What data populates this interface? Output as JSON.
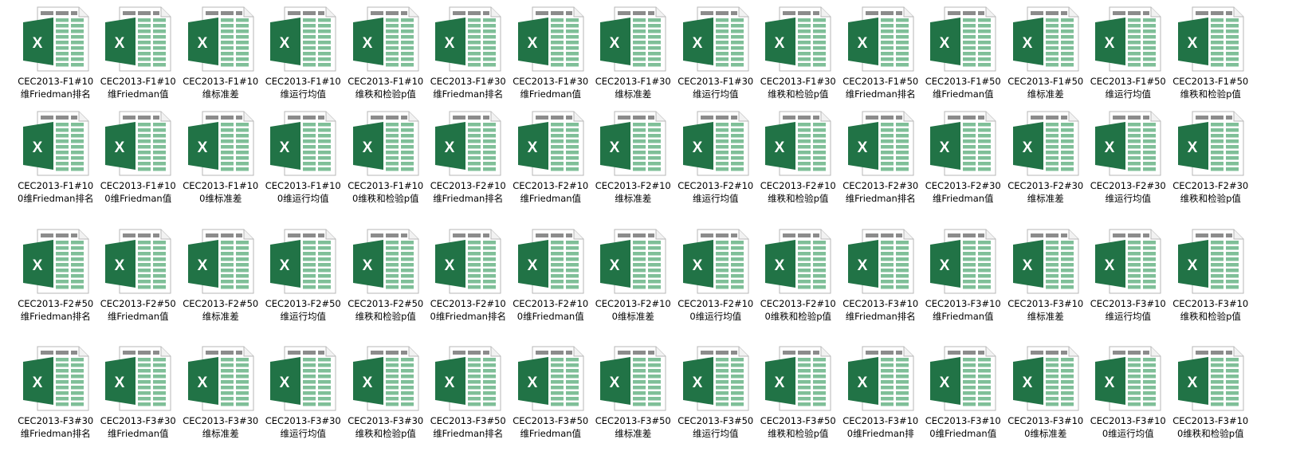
{
  "folder": {
    "files": [
      {
        "name": "CEC2013-F1#10维Friedman排名"
      },
      {
        "name": "CEC2013-F1#10维Friedman值"
      },
      {
        "name": "CEC2013-F1#10维标准差"
      },
      {
        "name": "CEC2013-F1#10维运行均值"
      },
      {
        "name": "CEC2013-F1#10维秩和检验p值"
      },
      {
        "name": "CEC2013-F1#30维Friedman排名"
      },
      {
        "name": "CEC2013-F1#30维Friedman值"
      },
      {
        "name": "CEC2013-F1#30维标准差"
      },
      {
        "name": "CEC2013-F1#30维运行均值"
      },
      {
        "name": "CEC2013-F1#30维秩和检验p值"
      },
      {
        "name": "CEC2013-F1#50维Friedman排名"
      },
      {
        "name": "CEC2013-F1#50维Friedman值"
      },
      {
        "name": "CEC2013-F1#50维标准差"
      },
      {
        "name": "CEC2013-F1#50维运行均值"
      },
      {
        "name": "CEC2013-F1#50维秩和检验p值"
      },
      {
        "name": "CEC2013-F1#100维Friedman排名"
      },
      {
        "name": "CEC2013-F1#100维Friedman值"
      },
      {
        "name": "CEC2013-F1#100维标准差"
      },
      {
        "name": "CEC2013-F1#100维运行均值"
      },
      {
        "name": "CEC2013-F1#100维秩和检验p值"
      },
      {
        "name": "CEC2013-F2#10维Friedman排名"
      },
      {
        "name": "CEC2013-F2#10维Friedman值"
      },
      {
        "name": "CEC2013-F2#10维标准差"
      },
      {
        "name": "CEC2013-F2#10维运行均值"
      },
      {
        "name": "CEC2013-F2#10维秩和检验p值"
      },
      {
        "name": "CEC2013-F2#30维Friedman排名"
      },
      {
        "name": "CEC2013-F2#30维Friedman值"
      },
      {
        "name": "CEC2013-F2#30维标准差"
      },
      {
        "name": "CEC2013-F2#30维运行均值"
      },
      {
        "name": "CEC2013-F2#30维秩和检验p值"
      },
      {
        "name": "CEC2013-F2#50维Friedman排名"
      },
      {
        "name": "CEC2013-F2#50维Friedman值"
      },
      {
        "name": "CEC2013-F2#50维标准差"
      },
      {
        "name": "CEC2013-F2#50维运行均值"
      },
      {
        "name": "CEC2013-F2#50维秩和检验p值"
      },
      {
        "name": "CEC2013-F2#100维Friedman排名"
      },
      {
        "name": "CEC2013-F2#100维Friedman值"
      },
      {
        "name": "CEC2013-F2#100维标准差"
      },
      {
        "name": "CEC2013-F2#100维运行均值"
      },
      {
        "name": "CEC2013-F2#100维秩和检验p值"
      },
      {
        "name": "CEC2013-F3#10维Friedman排名"
      },
      {
        "name": "CEC2013-F3#10维Friedman值"
      },
      {
        "name": "CEC2013-F3#10维标准差"
      },
      {
        "name": "CEC2013-F3#10维运行均值"
      },
      {
        "name": "CEC2013-F3#10维秩和检验p值"
      },
      {
        "name": "CEC2013-F3#30维Friedman排名"
      },
      {
        "name": "CEC2013-F3#30维Friedman值"
      },
      {
        "name": "CEC2013-F3#30维标准差"
      },
      {
        "name": "CEC2013-F3#30维运行均值"
      },
      {
        "name": "CEC2013-F3#30维秩和检验p值"
      },
      {
        "name": "CEC2013-F3#50维Friedman排名"
      },
      {
        "name": "CEC2013-F3#50维Friedman值"
      },
      {
        "name": "CEC2013-F3#50维标准差"
      },
      {
        "name": "CEC2013-F3#50维运行均值"
      },
      {
        "name": "CEC2013-F3#50维秩和检验p值"
      },
      {
        "name": "CEC2013-F3#100维Friedman排"
      },
      {
        "name": "CEC2013-F3#100维Friedman值"
      },
      {
        "name": "CEC2013-F3#100维标准差"
      },
      {
        "name": "CEC2013-F3#100维运行均值"
      },
      {
        "name": "CEC2013-F3#100维秩和检验p值"
      }
    ]
  },
  "icon": {
    "name": "excel-file-icon",
    "badge_letter": "X",
    "colors": {
      "excel_green": "#217346",
      "cell_green": "#7fbf98",
      "header_gray": "#8c8c8c",
      "page_border": "#b7b7b7",
      "page_fill": "#ffffff"
    }
  }
}
